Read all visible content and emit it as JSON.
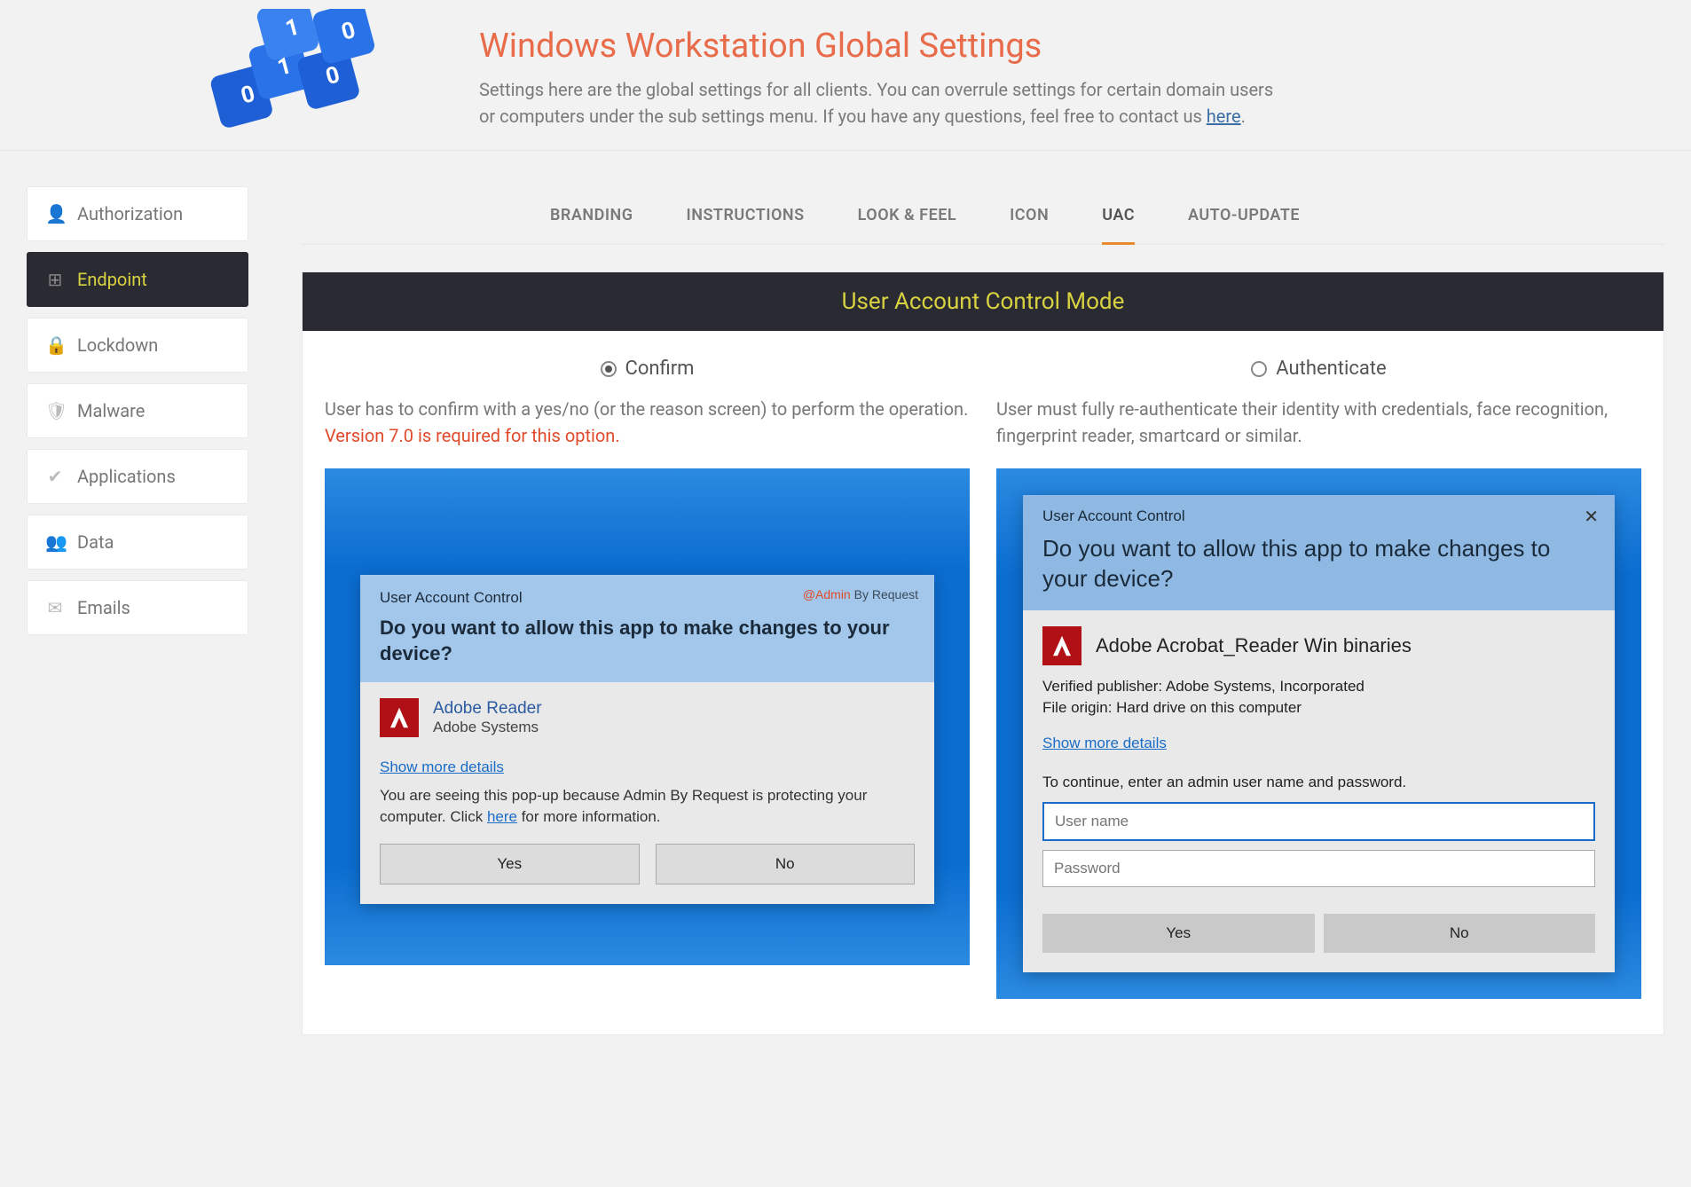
{
  "header": {
    "title": "Windows Workstation Global Settings",
    "subtitle_1": "Settings here are the global settings for all clients. You can overrule settings for certain domain users or computers under the sub settings menu. If you have any questions, feel free to contact us ",
    "subtitle_link": "here",
    "subtitle_2": "."
  },
  "sidebar": {
    "items": [
      {
        "label": "Authorization",
        "icon": "👤",
        "active": false
      },
      {
        "label": "Endpoint",
        "icon": "⊞",
        "active": true
      },
      {
        "label": "Lockdown",
        "icon": "🔒",
        "active": false
      },
      {
        "label": "Malware",
        "icon": "🛡",
        "active": false
      },
      {
        "label": "Applications",
        "icon": "✔",
        "active": false
      },
      {
        "label": "Data",
        "icon": "👥",
        "active": false
      },
      {
        "label": "Emails",
        "icon": "✉",
        "active": false
      }
    ]
  },
  "tabs": [
    {
      "label": "BRANDING",
      "active": false
    },
    {
      "label": "INSTRUCTIONS",
      "active": false
    },
    {
      "label": "LOOK & FEEL",
      "active": false
    },
    {
      "label": "ICON",
      "active": false
    },
    {
      "label": "UAC",
      "active": true
    },
    {
      "label": "AUTO-UPDATE",
      "active": false
    }
  ],
  "panel": {
    "title": "User Account Control Mode"
  },
  "modes": {
    "confirm": {
      "label": "Confirm",
      "selected": true,
      "desc_1": "User has to confirm with a yes/no (or the reason screen) to perform the operation. ",
      "desc_req": "Version 7.0 is required for this option."
    },
    "authenticate": {
      "label": "Authenticate",
      "selected": false,
      "desc": "User must fully re-authenticate their identity with credentials, face recognition, fingerprint reader, smartcard or similar."
    }
  },
  "uac_left": {
    "titlebar": "User Account Control",
    "brand_at": "@Admin",
    "brand_rest": " By Request",
    "question": "Do you want to allow this app to make changes to your device?",
    "app_name": "Adobe Reader",
    "app_publisher": "Adobe Systems",
    "details_link": "Show more details",
    "info_1": "You are seeing this pop-up because Admin By Request is protecting your computer. Click ",
    "info_link": "here",
    "info_2": " for more information.",
    "yes": "Yes",
    "no": "No"
  },
  "uac_right": {
    "titlebar": "User Account Control",
    "question": "Do you want to allow this app to make changes to your device?",
    "app_name": "Adobe Acrobat_Reader Win binaries",
    "publisher_line": "Verified publisher: Adobe Systems, Incorporated",
    "origin_line": "File origin: Hard drive on this computer",
    "details_link": "Show more details",
    "continue_text": "To continue, enter an admin user name and password.",
    "username_placeholder": "User name",
    "password_placeholder": "Password",
    "yes": "Yes",
    "no": "No"
  }
}
